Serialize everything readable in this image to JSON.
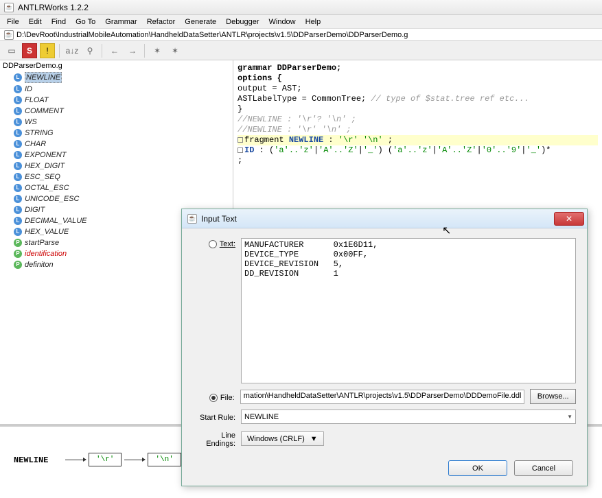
{
  "window": {
    "title": "ANTLRWorks 1.2.2"
  },
  "menu": [
    "File",
    "Edit",
    "Find",
    "Go To",
    "Grammar",
    "Refactor",
    "Generate",
    "Debugger",
    "Window",
    "Help"
  ],
  "path": "D:\\DevRoot\\IndustrialMobileAutomation\\HandheldDataSetter\\ANTLR\\projects\\v1.5\\DDParserDemo\\DDParserDemo.g",
  "toolbar": {
    "stop": "S",
    "warn": "!",
    "sort": "a↓z",
    "find": "⚲",
    "prev": "←",
    "next": "→",
    "debug1": "✶",
    "debug2": "✶"
  },
  "tree": {
    "root": "DDParserDemo.g",
    "items": [
      {
        "label": "NEWLINE",
        "type": "L",
        "selected": true
      },
      {
        "label": "ID",
        "type": "L"
      },
      {
        "label": "FLOAT",
        "type": "L"
      },
      {
        "label": "COMMENT",
        "type": "L"
      },
      {
        "label": "WS",
        "type": "L"
      },
      {
        "label": "STRING",
        "type": "L"
      },
      {
        "label": "CHAR",
        "type": "L"
      },
      {
        "label": "EXPONENT",
        "type": "L"
      },
      {
        "label": "HEX_DIGIT",
        "type": "L"
      },
      {
        "label": "ESC_SEQ",
        "type": "L"
      },
      {
        "label": "OCTAL_ESC",
        "type": "L"
      },
      {
        "label": "UNICODE_ESC",
        "type": "L"
      },
      {
        "label": "DIGIT",
        "type": "L"
      },
      {
        "label": "DECIMAL_VALUE",
        "type": "L"
      },
      {
        "label": "HEX_VALUE",
        "type": "L"
      },
      {
        "label": "startParse",
        "type": "P"
      },
      {
        "label": "identification",
        "type": "P",
        "red": true
      },
      {
        "label": "definiton",
        "type": "P"
      }
    ]
  },
  "editor": {
    "l1": "grammar DDParserDemo;",
    "l2": "",
    "l3": "options {",
    "l4": "    output = AST;",
    "l5a": "    ASTLabelType = CommonTree; ",
    "l5b": "// type of $stat.tree ref etc...",
    "l6": "}",
    "l7": "",
    "l8": "//NEWLINE :   '\\r'? '\\n' ;",
    "l9": "//NEWLINE :   '\\r' '\\n' ;",
    "l10a": "fragment ",
    "l10b": "NEWLINE",
    "l10c": " :   ",
    "l10d": "'\\r' '\\n'",
    "l10e": " ;",
    "l11": "",
    "l12a": "ID",
    "l12b": "  :   (",
    "l12c": "'a'..'z'",
    "l12d": "|",
    "l12e": "'A'..'Z'",
    "l12f": "|",
    "l12g": "'_'",
    "l12h": ") (",
    "l12i": "'a'..'z'",
    "l12j": "|",
    "l12k": "'A'..'Z'",
    "l12l": "|",
    "l12m": "'0'..'9'",
    "l12n": "|",
    "l12o": "'_'",
    "l12p": ")*",
    "l13": "    ;"
  },
  "diagram": {
    "rule": "NEWLINE",
    "box1": "'\\r'",
    "box2": "'\\n'"
  },
  "dialog": {
    "title": "Input Text",
    "text_label": "Text:",
    "text_value": "MANUFACTURER      0x1E6D11,\nDEVICE_TYPE       0x00FF,\nDEVICE_REVISION   5,\nDD_REVISION       1",
    "file_label": "File:",
    "file_value": "mation\\HandheldDataSetter\\ANTLR\\projects\\v1.5\\DDParserDemo\\DDDemoFile.ddl",
    "browse": "Browse...",
    "start_rule_label": "Start Rule:",
    "start_rule_value": "NEWLINE",
    "line_endings_label": "Line Endings:",
    "line_endings_value": "Windows (CRLF)",
    "ok": "OK",
    "cancel": "Cancel"
  }
}
